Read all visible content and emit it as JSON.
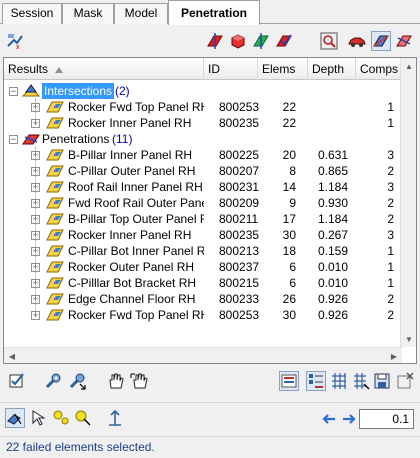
{
  "tabs": [
    {
      "label": "Session",
      "active": false
    },
    {
      "label": "Mask",
      "active": false
    },
    {
      "label": "Model",
      "active": false
    },
    {
      "label": "Penetration",
      "active": true
    }
  ],
  "tree": {
    "columns": {
      "name": "Results",
      "id": "ID",
      "elems": "Elems",
      "depth": "Depth",
      "comps": "Comps"
    },
    "groups": [
      {
        "label": "Intersections",
        "count": "(2)",
        "selected": true,
        "items": [
          {
            "name": "Rocker Fwd Top Panel RH",
            "id": "800253",
            "elems": "22",
            "depth": "",
            "comps": "1"
          },
          {
            "name": "Rocker Inner Panel RH",
            "id": "800235",
            "elems": "22",
            "depth": "",
            "comps": "1"
          }
        ]
      },
      {
        "label": "Penetrations",
        "count": "(11)",
        "selected": false,
        "items": [
          {
            "name": "B-Pillar Inner Panel RH",
            "id": "800225",
            "elems": "20",
            "depth": "0.631",
            "comps": "3"
          },
          {
            "name": "C-Pillar Outer Panel RH",
            "id": "800207",
            "elems": "8",
            "depth": "0.865",
            "comps": "2"
          },
          {
            "name": "Roof Rail Inner Panel RH",
            "id": "800231",
            "elems": "14",
            "depth": "1.184",
            "comps": "3"
          },
          {
            "name": "Fwd Roof Rail Outer Panel RH",
            "id": "800209",
            "elems": "9",
            "depth": "0.930",
            "comps": "2"
          },
          {
            "name": "B-Pillar Top Outer Panel RH",
            "id": "800211",
            "elems": "17",
            "depth": "1.184",
            "comps": "2"
          },
          {
            "name": "Rocker Inner Panel RH",
            "id": "800235",
            "elems": "30",
            "depth": "0.267",
            "comps": "3"
          },
          {
            "name": "C-Pillar Bot Inner Panel RH",
            "id": "800213",
            "elems": "18",
            "depth": "0.159",
            "comps": "1"
          },
          {
            "name": "Rocker Outer Panel RH",
            "id": "800237",
            "elems": "6",
            "depth": "0.010",
            "comps": "1"
          },
          {
            "name": "C-Pilllar Bot Bracket RH",
            "id": "800215",
            "elems": "6",
            "depth": "0.010",
            "comps": "1"
          },
          {
            "name": "Edge Channel Floor RH",
            "id": "800233",
            "elems": "26",
            "depth": "0.926",
            "comps": "2"
          },
          {
            "name": "Rocker Fwd Top Panel RH",
            "id": "800253",
            "elems": "30",
            "depth": "0.926",
            "comps": "2"
          }
        ]
      }
    ]
  },
  "icons": {
    "top_left": "check-penetration-icon",
    "top_right": [
      "red-plane-icon",
      "red-cube-icon",
      "green-plane-icon",
      "red-check-plane-icon",
      "zoom-fit-icon",
      "car-icon",
      "blue-plane-icon",
      "red-diag-plane-icon"
    ],
    "row2_left": [
      "checkbox-icon",
      "wrench-icon",
      "wrench-arrow-icon",
      "hand-icon",
      "hand-arrow-icon"
    ],
    "row2_right": [
      "results-view-icon",
      "list-view-icon",
      "grid-icon",
      "grid-arrow-icon",
      "save-grid-icon",
      "close-grid-icon"
    ],
    "row3_left": [
      "node-pick-icon",
      "pointer-icon",
      "yellow-dots-icon",
      "yellow-point-icon",
      "ruler-icon"
    ],
    "row3_right": [
      "arrow-left-icon",
      "arrow-right-icon"
    ]
  },
  "scale_value": "0.1",
  "status": "22 failed elements selected.",
  "colors": {
    "selection": "#3399ff",
    "count": "#0000c0",
    "status": "#1b3d8f"
  }
}
